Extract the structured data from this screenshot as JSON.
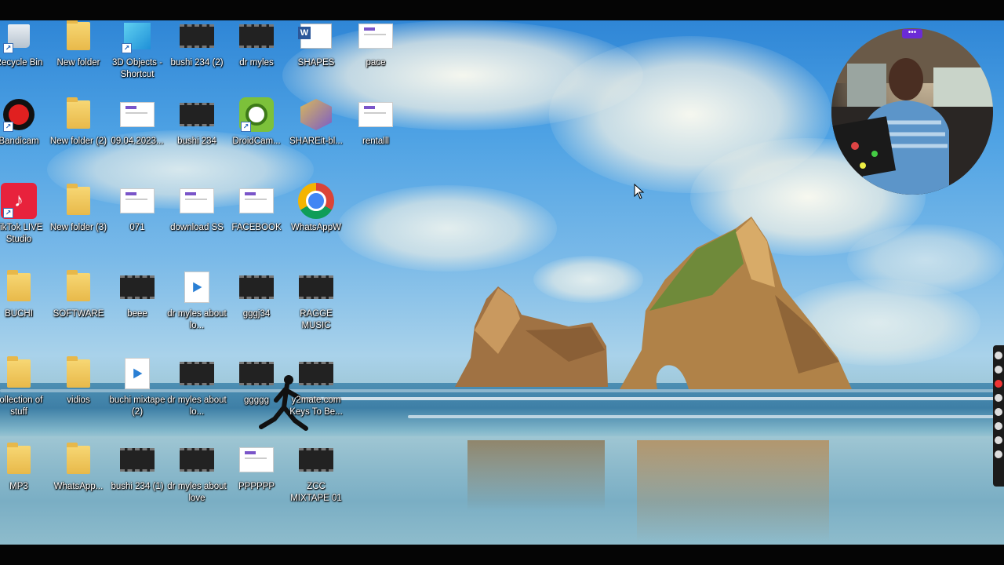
{
  "desktop": {
    "icons": [
      {
        "label": "Recycle Bin",
        "icon": "recycle-bin-icon"
      },
      {
        "label": "New folder",
        "icon": "folder-icon"
      },
      {
        "label": "3D Objects - Shortcut",
        "icon": "3d-objects-icon"
      },
      {
        "label": "bushi 234 (2)",
        "icon": "video-file-icon"
      },
      {
        "label": "dr myles",
        "icon": "video-file-icon"
      },
      {
        "label": "SHAPES",
        "icon": "word-document-icon"
      },
      {
        "label": "pace",
        "icon": "image-file-icon"
      },
      {
        "label": "Bandicam",
        "icon": "bandicam-icon"
      },
      {
        "label": "New folder (2)",
        "icon": "folder-icon"
      },
      {
        "label": "09.04.2023...",
        "icon": "image-file-icon"
      },
      {
        "label": "bushi 234",
        "icon": "video-file-icon"
      },
      {
        "label": "DroidCam...",
        "icon": "droidcam-icon"
      },
      {
        "label": "SHAREit-bl...",
        "icon": "shareit-icon"
      },
      {
        "label": "rentalll",
        "icon": "image-file-icon"
      },
      {
        "label": "TikTok LIVE Studio",
        "icon": "tiktok-icon"
      },
      {
        "label": "New folder (3)",
        "icon": "folder-icon"
      },
      {
        "label": "071",
        "icon": "image-file-icon"
      },
      {
        "label": "download SS",
        "icon": "image-file-icon"
      },
      {
        "label": "FACEBOOK",
        "icon": "image-file-icon"
      },
      {
        "label": "WhatsAppW",
        "icon": "chrome-icon"
      },
      {
        "label": "BUCHI",
        "icon": "folder-icon"
      },
      {
        "label": "SOFTWARE",
        "icon": "folder-icon"
      },
      {
        "label": "beee",
        "icon": "video-file-icon"
      },
      {
        "label": "dr myles about lo...",
        "icon": "media-player-icon"
      },
      {
        "label": "gggj34",
        "icon": "video-file-icon"
      },
      {
        "label": "RAGGE MUSIC",
        "icon": "video-file-icon"
      },
      {
        "label": "collection of stuff",
        "icon": "folder-icon"
      },
      {
        "label": "vidios",
        "icon": "folder-icon"
      },
      {
        "label": "buchi mixtape (2)",
        "icon": "media-player-icon"
      },
      {
        "label": "dr myles about lo...",
        "icon": "video-file-icon"
      },
      {
        "label": "ggggg",
        "icon": "video-file-icon"
      },
      {
        "label": "y2mate.com Keys To Be...",
        "icon": "video-file-icon"
      },
      {
        "label": "MP3",
        "icon": "folder-icon"
      },
      {
        "label": "WhatsApp...",
        "icon": "folder-icon"
      },
      {
        "label": "bushi 234 (1)",
        "icon": "video-file-icon"
      },
      {
        "label": "dr myles about love",
        "icon": "video-file-icon"
      },
      {
        "label": "PPPPPP",
        "icon": "image-file-icon"
      },
      {
        "label": "ZCC MIXTAPE 01",
        "icon": "video-file-icon"
      }
    ]
  },
  "webcam": {
    "tag": "•••"
  },
  "colors": {
    "sky": "#4ea2e4",
    "folder": "#f0c75c",
    "accent": "#6b2bd6"
  }
}
